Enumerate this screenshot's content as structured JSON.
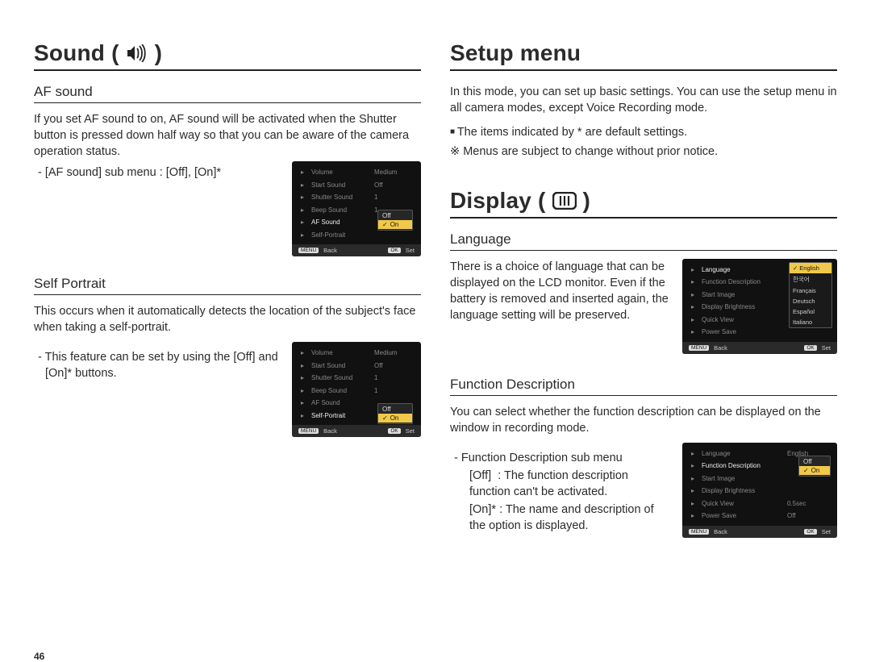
{
  "pageNumber": "46",
  "left": {
    "title": "Sound (",
    "titleClose": ")",
    "afSound": {
      "heading": "AF sound",
      "desc": "If you set AF sound to on, AF sound will be activated when the Shutter button is pressed down half way so that you can be aware of the camera operation status.",
      "sub": "AF sound] sub menu : [Off], [On]*",
      "subPrefix": "- [",
      "lcd": {
        "rows": [
          {
            "label": "Volume",
            "val": "Medium"
          },
          {
            "label": "Start Sound",
            "val": "Off"
          },
          {
            "label": "Shutter Sound",
            "val": "1"
          },
          {
            "label": "Beep Sound",
            "val": "1"
          },
          {
            "label": "AF Sound",
            "val": "",
            "hl": true
          },
          {
            "label": "Self-Portrait",
            "val": ""
          }
        ],
        "drop": {
          "off": "Off",
          "on": "On"
        },
        "foot": {
          "back": "Back",
          "set": "Set",
          "menu": "MENU",
          "ok": "OK"
        }
      }
    },
    "selfPortrait": {
      "heading": "Self Portrait",
      "desc": "This occurs when it automatically detects the location of the subject's face when taking a self-portrait.",
      "sub": "This feature can be set by using the [Off] and [On]* buttons.",
      "lcd": {
        "rows": [
          {
            "label": "Volume",
            "val": "Medium"
          },
          {
            "label": "Start Sound",
            "val": "Off"
          },
          {
            "label": "Shutter Sound",
            "val": "1"
          },
          {
            "label": "Beep Sound",
            "val": "1"
          },
          {
            "label": "AF Sound",
            "val": ""
          },
          {
            "label": "Self-Portrait",
            "val": "",
            "hl": true
          }
        ],
        "drop": {
          "off": "Off",
          "on": "On"
        },
        "foot": {
          "back": "Back",
          "set": "Set",
          "menu": "MENU",
          "ok": "OK"
        }
      }
    }
  },
  "right": {
    "setup": {
      "title": "Setup menu",
      "desc": "In this mode, you can set up basic settings. You can use the setup menu in all camera modes, except Voice Recording mode.",
      "bullet1": "The items indicated by * are default settings.",
      "bullet2": "Menus are subject to change without prior notice."
    },
    "display": {
      "title": "Display (",
      "titleClose": ")",
      "language": {
        "heading": "Language",
        "desc": "There is a choice of language that can be displayed on the LCD monitor. Even if the battery is removed and inserted again, the language setting will be preserved.",
        "lcd": {
          "rows": [
            {
              "label": "Language",
              "val": "",
              "hl": true
            },
            {
              "label": "Function Description",
              "val": ""
            },
            {
              "label": "Start Image",
              "val": ""
            },
            {
              "label": "Display Brightness",
              "val": ""
            },
            {
              "label": "Quick View",
              "val": ""
            },
            {
              "label": "Power Save",
              "val": ""
            }
          ],
          "langs": [
            "English",
            "한국어",
            "Français",
            "Deutsch",
            "Español",
            "Italiano"
          ],
          "foot": {
            "back": "Back",
            "set": "Set",
            "menu": "MENU",
            "ok": "OK"
          }
        }
      },
      "funcDesc": {
        "heading": "Function Description",
        "desc": "You can select whether the function description can be displayed on the window in recording mode.",
        "sub": "Function Description sub menu",
        "offLabel": "[Off]",
        "offText": ": The function description function can't be activated.",
        "onLabel": "[On]*",
        "onText": ": The name and description of the option is displayed.",
        "lcd": {
          "rows": [
            {
              "label": "Language",
              "val": "English"
            },
            {
              "label": "Function Description",
              "val": "",
              "hl": true
            },
            {
              "label": "Start Image",
              "val": ""
            },
            {
              "label": "Display Brightness",
              "val": ""
            },
            {
              "label": "Quick View",
              "val": "0.5sec"
            },
            {
              "label": "Power Save",
              "val": "Off"
            }
          ],
          "drop": {
            "off": "Off",
            "on": "On"
          },
          "foot": {
            "back": "Back",
            "set": "Set",
            "menu": "MENU",
            "ok": "OK"
          }
        }
      }
    }
  }
}
